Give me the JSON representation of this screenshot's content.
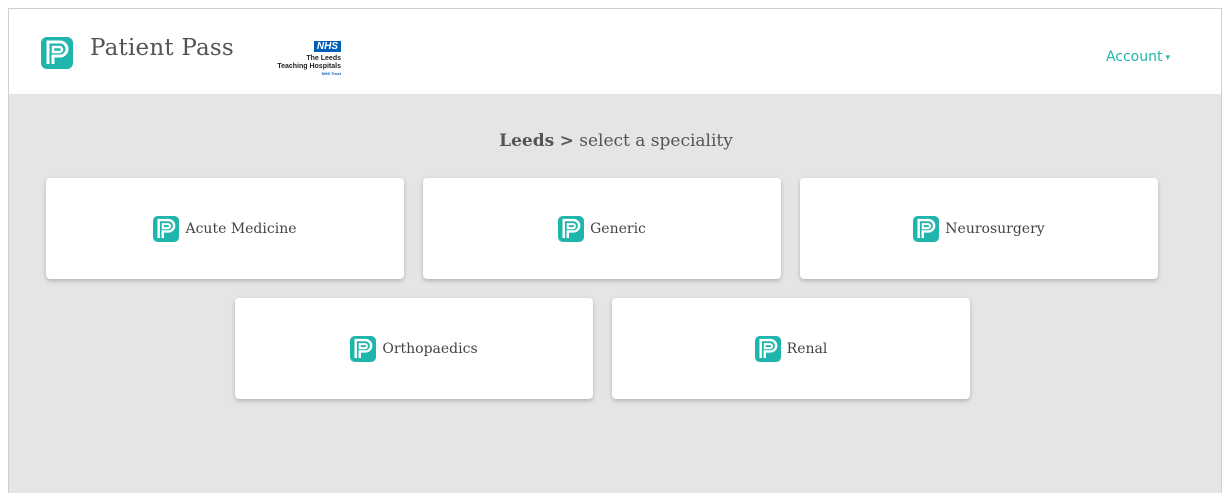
{
  "brand": {
    "name": "Patient Pass",
    "logo_icon": "patient-pass-p-logo"
  },
  "trust_logo": {
    "badge": "NHS",
    "line1": "The Leeds",
    "line2": "Teaching Hospitals",
    "line3": "NHS Trust"
  },
  "nav": {
    "account_label": "Account",
    "account_caret": "▾"
  },
  "heading": {
    "location": "Leeds",
    "separator": ">",
    "instruction": "select a speciality"
  },
  "specialities": [
    {
      "label": "Acute Medicine",
      "icon": "patient-pass-p-logo"
    },
    {
      "label": "Generic",
      "icon": "patient-pass-p-logo"
    },
    {
      "label": "Neurosurgery",
      "icon": "patient-pass-p-logo"
    },
    {
      "label": "Orthopaedics",
      "icon": "patient-pass-p-logo"
    },
    {
      "label": "Renal",
      "icon": "patient-pass-p-logo"
    }
  ],
  "colors": {
    "brand_teal": "#1fb5ac",
    "nhs_blue": "#005eb8",
    "background": "#e4e5e4"
  }
}
